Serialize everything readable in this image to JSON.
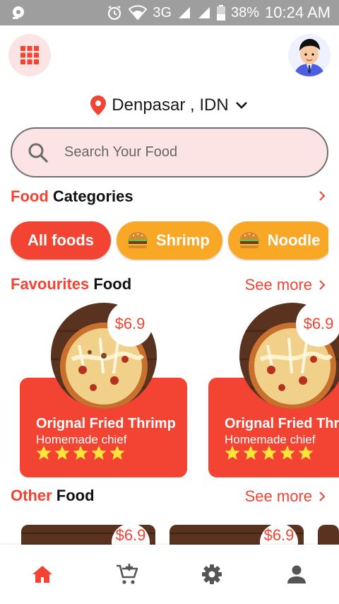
{
  "status_bar": {
    "network": "3G",
    "battery": "38%",
    "time": "10:24 AM"
  },
  "header": {
    "location": "Denpasar , IDN"
  },
  "search": {
    "placeholder": "Search Your Food"
  },
  "categories": {
    "title_accent": "Food",
    "title_rest": " Categories",
    "items": [
      {
        "label": "All foods",
        "active": true
      },
      {
        "label": "Shrimp",
        "active": false
      },
      {
        "label": "Noodle",
        "active": false
      }
    ]
  },
  "favourites": {
    "title_accent": "Favourites",
    "title_rest": " Food",
    "see_more": "See more",
    "items": [
      {
        "name": "Orignal Fried Thrimp",
        "subtitle": "Homemade chief",
        "price": "$6.9",
        "rating": 5
      },
      {
        "name": "Orignal Fried Thrimp",
        "subtitle": "Homemade chief",
        "price": "$6.9",
        "rating": 5
      }
    ]
  },
  "other": {
    "title_accent": "Other",
    "title_rest": " Food",
    "see_more": "See more",
    "items": [
      {
        "price": "$6.9"
      },
      {
        "price": "$6.9"
      }
    ]
  },
  "colors": {
    "accent": "#f24333",
    "chip_orange": "#f9a826",
    "search_bg": "#fde4e4"
  },
  "bottom_nav": {
    "items": [
      "home-icon",
      "cart-add-icon",
      "settings-icon",
      "profile-icon"
    ],
    "active": "home-icon"
  }
}
